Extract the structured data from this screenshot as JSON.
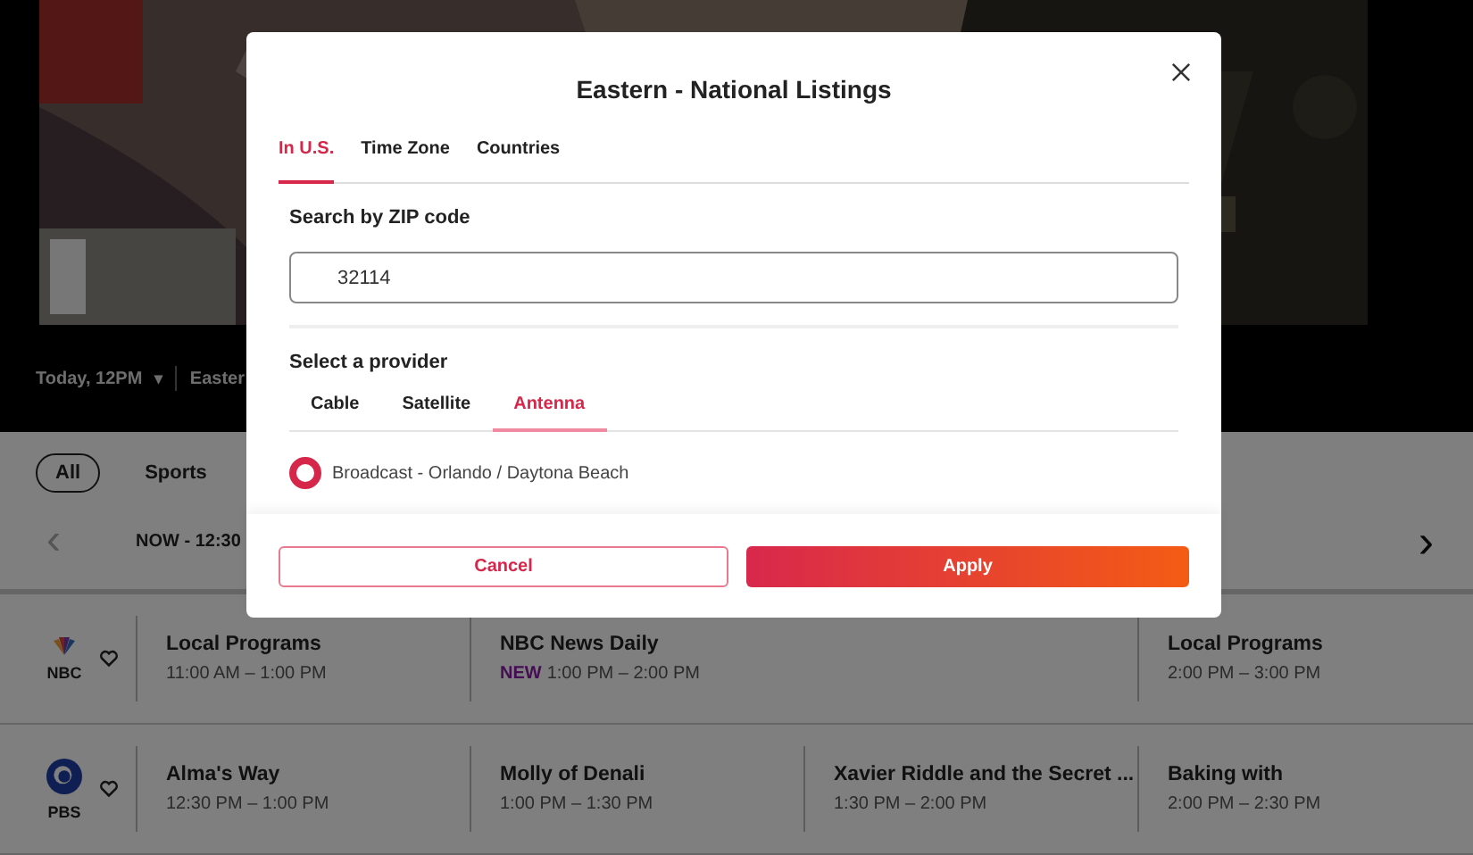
{
  "header": {
    "date": "Today, 12PM",
    "caret": "▾",
    "region": "Easter"
  },
  "filters": [
    {
      "label": "All",
      "selected": true
    },
    {
      "label": "Sports",
      "selected": false
    }
  ],
  "timeline": {
    "prev": "‹",
    "now": "NOW - 12:30",
    "next": "›"
  },
  "channels": [
    {
      "name": "NBC",
      "kind": "nbc",
      "programs": [
        {
          "title": "Local Programs",
          "time": "11:00 AM – 1:00 PM",
          "wide": false
        },
        {
          "title": "NBC News Daily",
          "badge": "NEW",
          "time": "1:00 PM – 2:00 PM",
          "wide": true
        },
        {
          "title": "Local Programs",
          "time": "2:00 PM – 3:00 PM",
          "wide": false
        }
      ]
    },
    {
      "name": "PBS",
      "kind": "pbs",
      "programs": [
        {
          "title": "Alma's Way",
          "time": "12:30 PM – 1:00 PM",
          "wide": false
        },
        {
          "title": "Molly of Denali",
          "time": "1:00 PM – 1:30 PM",
          "wide": false
        },
        {
          "title": "Xavier Riddle and the Secret ...",
          "time": "1:30 PM – 2:00 PM",
          "wide": false
        },
        {
          "title": "Baking with",
          "time": "2:00 PM – 2:30 PM",
          "wide": false
        }
      ]
    }
  ],
  "dialog": {
    "title": "Eastern - National Listings",
    "tabs": [
      {
        "label": "In U.S.",
        "selected": true
      },
      {
        "label": "Time Zone",
        "selected": false
      },
      {
        "label": "Countries",
        "selected": false
      }
    ],
    "zip_label": "Search by ZIP code",
    "zip_value": "32114",
    "provider_label": "Select a provider",
    "provider_tabs": [
      {
        "label": "Cable",
        "selected": false
      },
      {
        "label": "Satellite",
        "selected": false
      },
      {
        "label": "Antenna",
        "selected": true
      }
    ],
    "options": [
      {
        "label": "Broadcast - Orlando / Daytona Beach",
        "selected": true
      }
    ],
    "buttons": [
      {
        "label": "Cancel",
        "kind": "secondary"
      },
      {
        "label": "Apply",
        "kind": "primary"
      }
    ]
  }
}
